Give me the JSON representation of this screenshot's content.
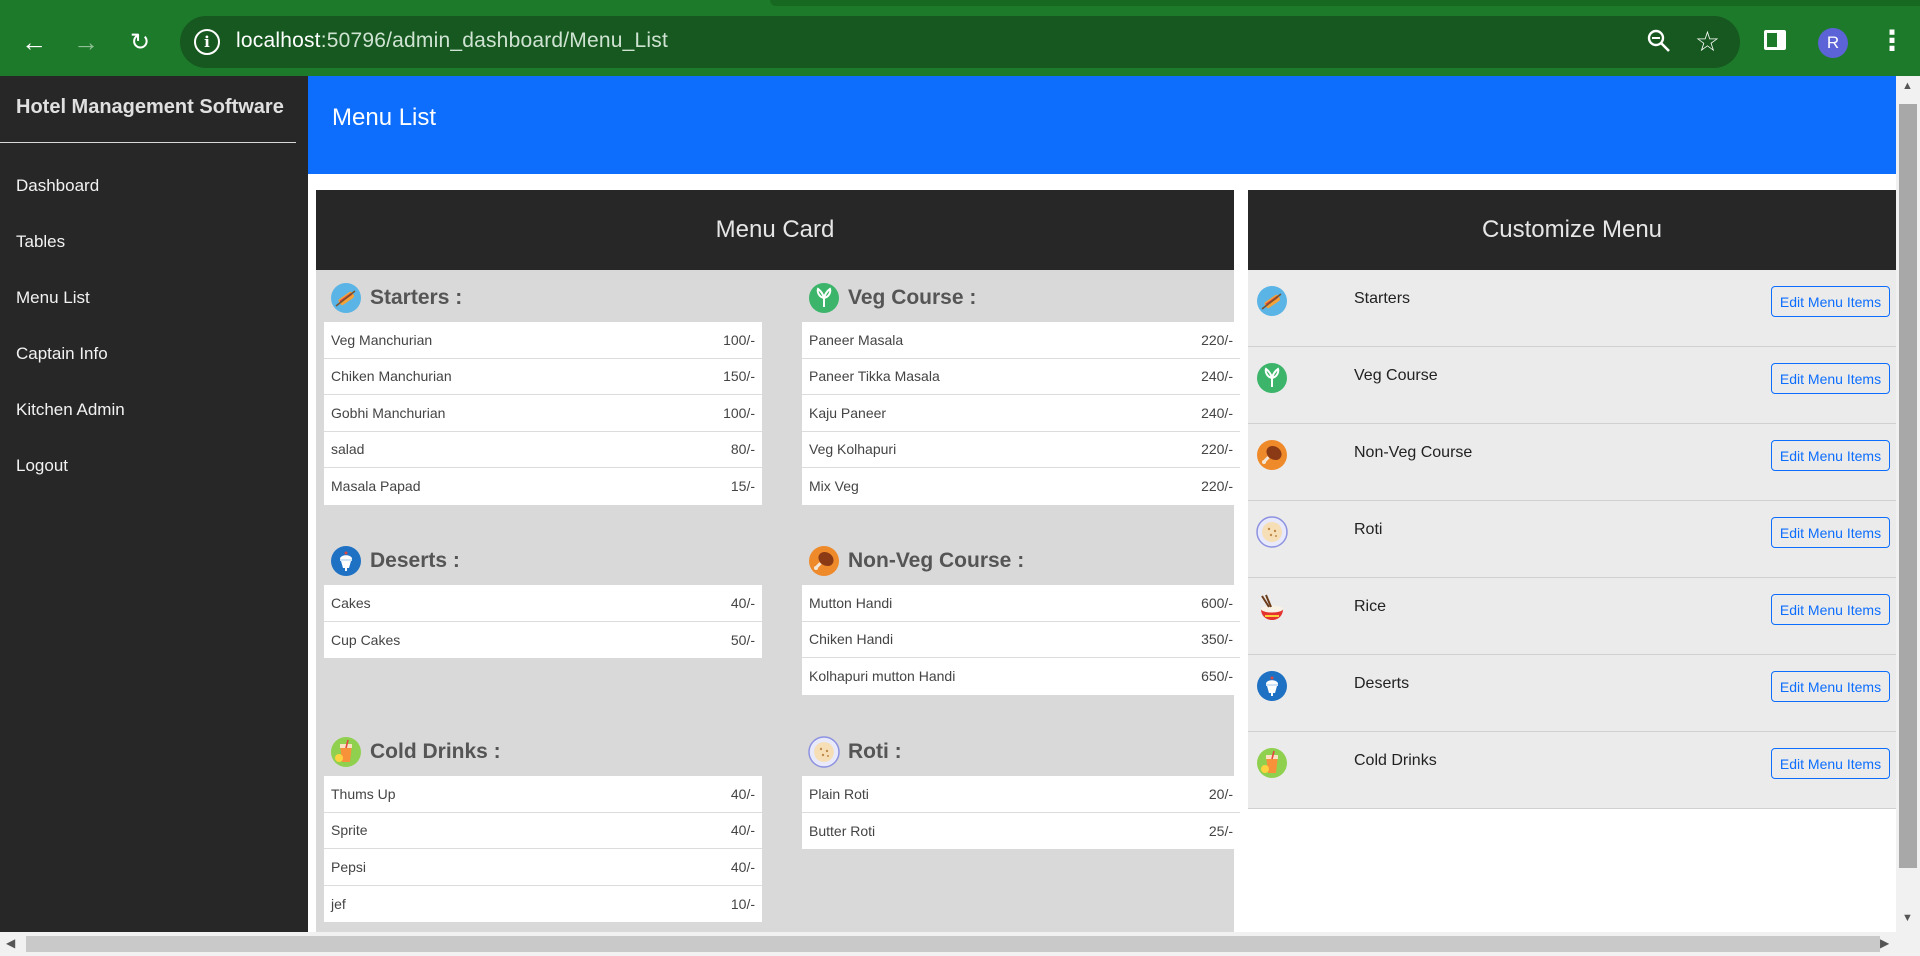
{
  "browser": {
    "url_host": "localhost",
    "url_rest": ":50796/admin_dashboard/Menu_List",
    "avatar_letter": "R"
  },
  "sidebar": {
    "brand": "Hotel Management Software",
    "items": [
      {
        "label": "Dashboard"
      },
      {
        "label": "Tables"
      },
      {
        "label": "Menu List"
      },
      {
        "label": "Captain Info"
      },
      {
        "label": "Kitchen Admin"
      },
      {
        "label": "Logout"
      }
    ]
  },
  "header": {
    "title": "Menu List"
  },
  "menu_card": {
    "title": "Menu Card",
    "sections": [
      {
        "title": "Starters :",
        "icon": "starters-icon",
        "items": [
          {
            "name": "Veg Manchurian",
            "price": "100/-"
          },
          {
            "name": "Chiken Manchurian",
            "price": "150/-"
          },
          {
            "name": "Gobhi Manchurian",
            "price": "100/-"
          },
          {
            "name": "salad",
            "price": "80/-"
          },
          {
            "name": "Masala Papad",
            "price": "15/-"
          }
        ]
      },
      {
        "title": "Veg Course :",
        "icon": "veg-icon",
        "items": [
          {
            "name": "Paneer Masala",
            "price": "220/-"
          },
          {
            "name": "Paneer Tikka Masala",
            "price": "240/-"
          },
          {
            "name": "Kaju Paneer",
            "price": "240/-"
          },
          {
            "name": "Veg Kolhapuri",
            "price": "220/-"
          },
          {
            "name": "Mix Veg",
            "price": "220/-"
          }
        ]
      },
      {
        "title": "Deserts :",
        "icon": "desserts-icon",
        "items": [
          {
            "name": "Cakes",
            "price": "40/-"
          },
          {
            "name": "Cup Cakes",
            "price": "50/-"
          }
        ]
      },
      {
        "title": "Non-Veg Course :",
        "icon": "non-veg-icon",
        "items": [
          {
            "name": "Mutton Handi",
            "price": "600/-"
          },
          {
            "name": "Chiken Handi",
            "price": "350/-"
          },
          {
            "name": "Kolhapuri mutton Handi",
            "price": "650/-"
          }
        ]
      },
      {
        "title": "Cold Drinks :",
        "icon": "cold-drinks-icon",
        "items": [
          {
            "name": "Thums Up",
            "price": "40/-"
          },
          {
            "name": "Sprite",
            "price": "40/-"
          },
          {
            "name": "Pepsi",
            "price": "40/-"
          },
          {
            "name": "jef",
            "price": "10/-"
          }
        ]
      },
      {
        "title": "Roti :",
        "icon": "roti-icon",
        "items": [
          {
            "name": "Plain Roti",
            "price": "20/-"
          },
          {
            "name": "Butter Roti",
            "price": "25/-"
          }
        ]
      }
    ]
  },
  "customize": {
    "title": "Customize Menu",
    "button_label": "Edit Menu Items",
    "items": [
      {
        "name": "Starters",
        "icon": "starters-icon"
      },
      {
        "name": "Veg Course",
        "icon": "veg-icon"
      },
      {
        "name": "Non-Veg Course",
        "icon": "non-veg-icon"
      },
      {
        "name": "Roti",
        "icon": "roti-icon"
      },
      {
        "name": "Rice",
        "icon": "rice-icon"
      },
      {
        "name": "Deserts",
        "icon": "desserts-icon"
      },
      {
        "name": "Cold Drinks",
        "icon": "cold-drinks-icon"
      }
    ]
  }
}
